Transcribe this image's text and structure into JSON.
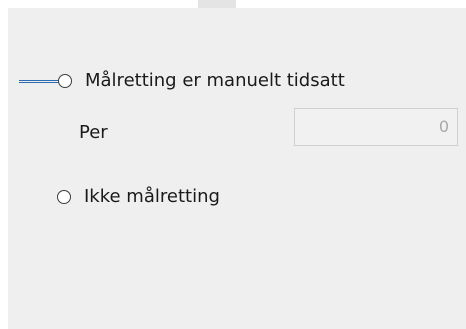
{
  "targeting": {
    "option_manual_label": "Målretting er manuelt tidsatt",
    "per_label": "Per",
    "per_value": "0",
    "option_none_label": "Ikke målretting"
  }
}
